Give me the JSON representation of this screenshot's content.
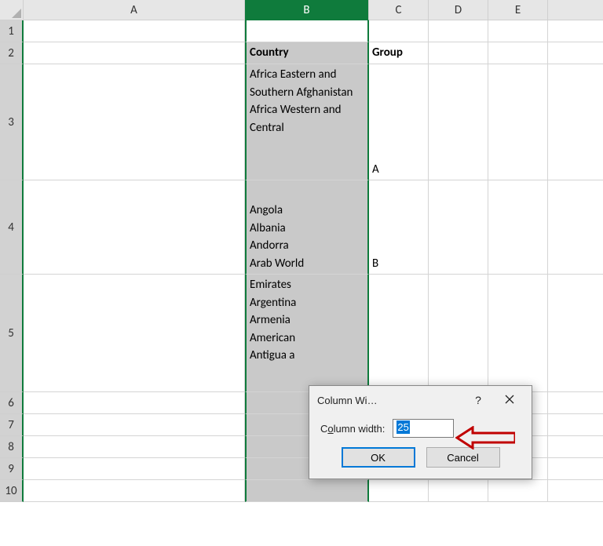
{
  "columns": [
    "A",
    "B",
    "C",
    "D",
    "E"
  ],
  "rows": [
    1,
    2,
    3,
    4,
    5,
    6,
    7,
    8,
    9,
    10
  ],
  "selected_column": "B",
  "cells": {
    "B2": "Country",
    "C2": "Group",
    "B3": "Africa Eastern and Southern Afghanistan Africa Western and Central",
    "C3": "A",
    "B4": "Angola\nAlbania\nAndorra\nArab World",
    "C4": "B",
    "B5": "Emirates\nArgentina\nArmenia\nAmerican\nAntigua a"
  },
  "dialog": {
    "title": "Column Wi…",
    "field_label_pre": "C",
    "field_label_u": "o",
    "field_label_post": "lumn width:",
    "value": "25",
    "ok_label": "OK",
    "cancel_label": "Cancel",
    "help_label": "?"
  }
}
